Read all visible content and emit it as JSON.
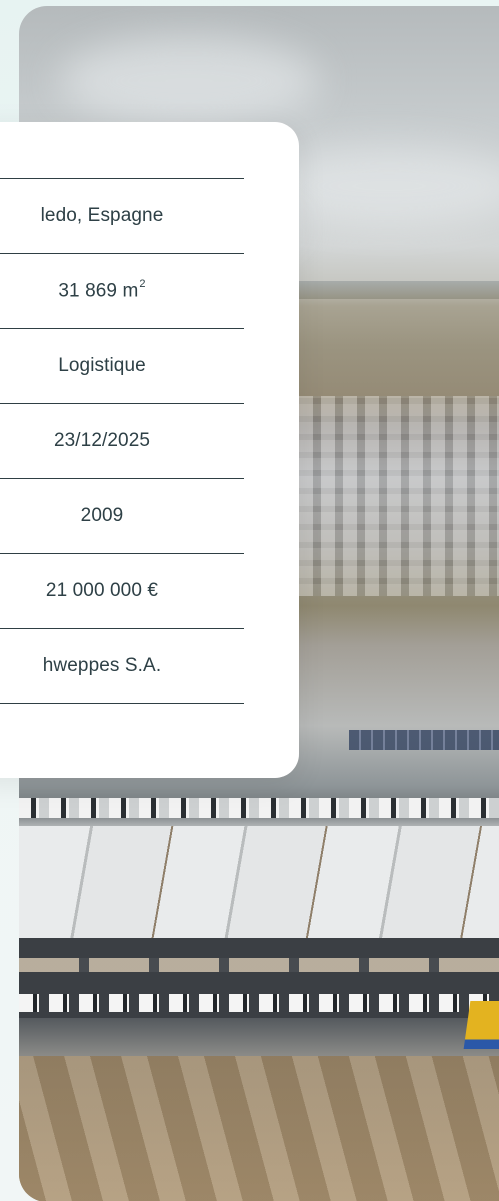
{
  "property_details": {
    "location": "ledo, Espagne",
    "surface_value": "31 869 m",
    "surface_sup": "2",
    "type": "Logistique",
    "date": "23/12/2025",
    "year": "2009",
    "price": "21 000 000 €",
    "tenant": "hweppes S.A."
  }
}
